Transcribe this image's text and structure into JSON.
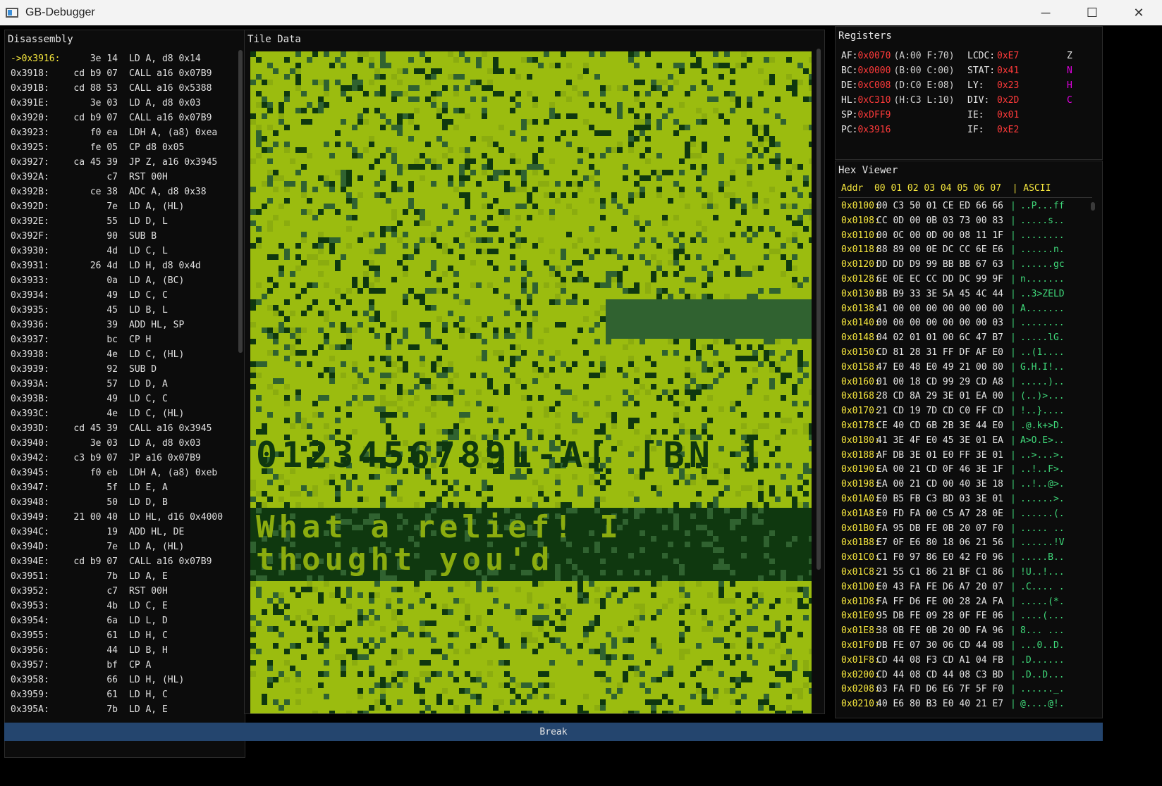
{
  "window": {
    "title": "GB-Debugger",
    "minimize": "─",
    "maximize": "☐",
    "close": "✕"
  },
  "disassembly": {
    "title": "Disassembly",
    "rows": [
      {
        "addr": "->0x3916:",
        "bytes": "3e 14",
        "instr": "LD A, d8 0x14",
        "current": true
      },
      {
        "addr": "0x3918:",
        "bytes": "cd b9 07",
        "instr": "CALL a16 0x07B9"
      },
      {
        "addr": "0x391B:",
        "bytes": "cd 88 53",
        "instr": "CALL a16 0x5388"
      },
      {
        "addr": "0x391E:",
        "bytes": "3e 03",
        "instr": "LD A, d8 0x03"
      },
      {
        "addr": "0x3920:",
        "bytes": "cd b9 07",
        "instr": "CALL a16 0x07B9"
      },
      {
        "addr": "0x3923:",
        "bytes": "f0 ea",
        "instr": "LDH A, (a8) 0xea"
      },
      {
        "addr": "0x3925:",
        "bytes": "fe 05",
        "instr": "CP d8 0x05"
      },
      {
        "addr": "0x3927:",
        "bytes": "ca 45 39",
        "instr": "JP Z, a16 0x3945"
      },
      {
        "addr": "0x392A:",
        "bytes": "c7",
        "instr": "RST 00H"
      },
      {
        "addr": "0x392B:",
        "bytes": "ce 38",
        "instr": "ADC A, d8 0x38"
      },
      {
        "addr": "0x392D:",
        "bytes": "7e",
        "instr": "LD A, (HL)"
      },
      {
        "addr": "0x392E:",
        "bytes": "55",
        "instr": "LD D, L"
      },
      {
        "addr": "0x392F:",
        "bytes": "90",
        "instr": "SUB B"
      },
      {
        "addr": "0x3930:",
        "bytes": "4d",
        "instr": "LD C, L"
      },
      {
        "addr": "0x3931:",
        "bytes": "26 4d",
        "instr": "LD H, d8 0x4d"
      },
      {
        "addr": "0x3933:",
        "bytes": "0a",
        "instr": "LD A, (BC)"
      },
      {
        "addr": "0x3934:",
        "bytes": "49",
        "instr": "LD C, C"
      },
      {
        "addr": "0x3935:",
        "bytes": "45",
        "instr": "LD B, L"
      },
      {
        "addr": "0x3936:",
        "bytes": "39",
        "instr": "ADD HL, SP"
      },
      {
        "addr": "0x3937:",
        "bytes": "bc",
        "instr": "CP H"
      },
      {
        "addr": "0x3938:",
        "bytes": "4e",
        "instr": "LD C, (HL)"
      },
      {
        "addr": "0x3939:",
        "bytes": "92",
        "instr": "SUB D"
      },
      {
        "addr": "0x393A:",
        "bytes": "57",
        "instr": "LD D, A"
      },
      {
        "addr": "0x393B:",
        "bytes": "49",
        "instr": "LD C, C"
      },
      {
        "addr": "0x393C:",
        "bytes": "4e",
        "instr": "LD C, (HL)"
      },
      {
        "addr": "0x393D:",
        "bytes": "cd 45 39",
        "instr": "CALL a16 0x3945"
      },
      {
        "addr": "0x3940:",
        "bytes": "3e 03",
        "instr": "LD A, d8 0x03"
      },
      {
        "addr": "0x3942:",
        "bytes": "c3 b9 07",
        "instr": "JP a16 0x07B9"
      },
      {
        "addr": "0x3945:",
        "bytes": "f0 eb",
        "instr": "LDH A, (a8) 0xeb"
      },
      {
        "addr": "0x3947:",
        "bytes": "5f",
        "instr": "LD E, A"
      },
      {
        "addr": "0x3948:",
        "bytes": "50",
        "instr": "LD D, B"
      },
      {
        "addr": "0x3949:",
        "bytes": "21 00 40",
        "instr": "LD HL, d16 0x4000"
      },
      {
        "addr": "0x394C:",
        "bytes": "19",
        "instr": "ADD HL, DE"
      },
      {
        "addr": "0x394D:",
        "bytes": "7e",
        "instr": "LD A, (HL)"
      },
      {
        "addr": "0x394E:",
        "bytes": "cd b9 07",
        "instr": "CALL a16 0x07B9"
      },
      {
        "addr": "0x3951:",
        "bytes": "7b",
        "instr": "LD A, E"
      },
      {
        "addr": "0x3952:",
        "bytes": "c7",
        "instr": "RST 00H"
      },
      {
        "addr": "0x3953:",
        "bytes": "4b",
        "instr": "LD C, E"
      },
      {
        "addr": "0x3954:",
        "bytes": "6a",
        "instr": "LD L, D"
      },
      {
        "addr": "0x3955:",
        "bytes": "61",
        "instr": "LD H, C"
      },
      {
        "addr": "0x3956:",
        "bytes": "44",
        "instr": "LD B, H"
      },
      {
        "addr": "0x3957:",
        "bytes": "bf",
        "instr": "CP A"
      },
      {
        "addr": "0x3958:",
        "bytes": "66",
        "instr": "LD H, (HL)"
      },
      {
        "addr": "0x3959:",
        "bytes": "61",
        "instr": "LD H, C"
      },
      {
        "addr": "0x395A:",
        "bytes": "7b",
        "instr": "LD A, E"
      }
    ]
  },
  "tile_data": {
    "title": "Tile Data",
    "palette": [
      "#9bbc0f",
      "#8bac0f",
      "#306230",
      "#0f380f"
    ],
    "digits_text": "0123456789L-A[ [BN ]",
    "message_line1": "What a relief! I",
    "message_line2": "thought you'd"
  },
  "registers": {
    "title": "Registers",
    "rows": [
      {
        "name": "AF:",
        "value": "0x0070",
        "detail": "(A:00 F:70)"
      },
      {
        "name": "BC:",
        "value": "0x0000",
        "detail": "(B:00 C:00)"
      },
      {
        "name": "DE:",
        "value": "0xC008",
        "detail": "(D:C0 E:08)"
      },
      {
        "name": "HL:",
        "value": "0xC310",
        "detail": "(H:C3 L:10)"
      },
      {
        "name": "SP:",
        "value": "0xDFF9",
        "detail": ""
      },
      {
        "name": "PC:",
        "value": "0x3916",
        "detail": ""
      }
    ],
    "io": [
      {
        "name": "LCDC:",
        "value": "0xE7"
      },
      {
        "name": "STAT:",
        "value": "0x41"
      },
      {
        "name": "LY:",
        "value": "0x23"
      },
      {
        "name": "DIV:",
        "value": "0x2D"
      },
      {
        "name": "IE:",
        "value": "0x01"
      },
      {
        "name": "IF:",
        "value": "0xE2"
      }
    ],
    "flags": [
      {
        "name": "Z",
        "color": "#e6e6e6"
      },
      {
        "name": "N",
        "color": "#e000e0"
      },
      {
        "name": "H",
        "color": "#e000e0"
      },
      {
        "name": "C",
        "color": "#e000e0"
      }
    ]
  },
  "hex_viewer": {
    "title": "Hex Viewer",
    "header": "Addr  00 01 02 03 04 05 06 07  | ASCII",
    "rows": [
      {
        "addr": "0x0100:",
        "bytes": "00 C3 50 01 CE ED 66 66",
        "ascii": "..P...ff"
      },
      {
        "addr": "0x0108:",
        "bytes": "CC 0D 00 0B 03 73 00 83",
        "ascii": ".....s.."
      },
      {
        "addr": "0x0110:",
        "bytes": "00 0C 00 0D 00 08 11 1F",
        "ascii": "........"
      },
      {
        "addr": "0x0118:",
        "bytes": "88 89 00 0E DC CC 6E E6",
        "ascii": "......n."
      },
      {
        "addr": "0x0120:",
        "bytes": "DD DD D9 99 BB BB 67 63",
        "ascii": "......gc"
      },
      {
        "addr": "0x0128:",
        "bytes": "6E 0E EC CC DD DC 99 9F",
        "ascii": "n......."
      },
      {
        "addr": "0x0130:",
        "bytes": "BB B9 33 3E 5A 45 4C 44",
        "ascii": "..3>ZELD"
      },
      {
        "addr": "0x0138:",
        "bytes": "41 00 00 00 00 00 00 00",
        "ascii": "A......."
      },
      {
        "addr": "0x0140:",
        "bytes": "00 00 00 00 00 00 00 03",
        "ascii": "........"
      },
      {
        "addr": "0x0148:",
        "bytes": "04 02 01 01 00 6C 47 B7",
        "ascii": ".....lG."
      },
      {
        "addr": "0x0150:",
        "bytes": "CD 81 28 31 FF DF AF E0",
        "ascii": "..(1...."
      },
      {
        "addr": "0x0158:",
        "bytes": "47 E0 48 E0 49 21 00 80",
        "ascii": "G.H.I!.."
      },
      {
        "addr": "0x0160:",
        "bytes": "01 00 18 CD 99 29 CD A8",
        "ascii": ".....).."
      },
      {
        "addr": "0x0168:",
        "bytes": "28 CD 8A 29 3E 01 EA 00",
        "ascii": "(..)>..."
      },
      {
        "addr": "0x0170:",
        "bytes": "21 CD 19 7D CD C0 FF CD",
        "ascii": "!..}...."
      },
      {
        "addr": "0x0178:",
        "bytes": "CE 40 CD 6B 2B 3E 44 E0",
        "ascii": ".@.k+>D."
      },
      {
        "addr": "0x0180:",
        "bytes": "41 3E 4F E0 45 3E 01 EA",
        "ascii": "A>O.E>.."
      },
      {
        "addr": "0x0188:",
        "bytes": "AF DB 3E 01 E0 FF 3E 01",
        "ascii": "..>...>."
      },
      {
        "addr": "0x0190:",
        "bytes": "EA 00 21 CD 0F 46 3E 1F",
        "ascii": "..!..F>."
      },
      {
        "addr": "0x0198:",
        "bytes": "EA 00 21 CD 00 40 3E 18",
        "ascii": "..!..@>."
      },
      {
        "addr": "0x01A0:",
        "bytes": "E0 B5 FB C3 BD 03 3E 01",
        "ascii": "......>."
      },
      {
        "addr": "0x01A8:",
        "bytes": "E0 FD FA 00 C5 A7 28 0E",
        "ascii": "......(."
      },
      {
        "addr": "0x01B0:",
        "bytes": "FA 95 DB FE 0B 20 07 F0",
        "ascii": "..... .."
      },
      {
        "addr": "0x01B8:",
        "bytes": "E7 0F E6 80 18 06 21 56",
        "ascii": "......!V"
      },
      {
        "addr": "0x01C0:",
        "bytes": "C1 F0 97 86 E0 42 F0 96",
        "ascii": ".....B.."
      },
      {
        "addr": "0x01C8:",
        "bytes": "21 55 C1 86 21 BF C1 86",
        "ascii": "!U..!..."
      },
      {
        "addr": "0x01D0:",
        "bytes": "E0 43 FA FE D6 A7 20 07",
        "ascii": ".C.... ."
      },
      {
        "addr": "0x01D8:",
        "bytes": "FA FF D6 FE 00 28 2A FA",
        "ascii": ".....(*."
      },
      {
        "addr": "0x01E0:",
        "bytes": "95 DB FE 09 28 0F FE 06",
        "ascii": "....(..."
      },
      {
        "addr": "0x01E8:",
        "bytes": "38 0B FE 0B 20 0D FA 96",
        "ascii": "8... ..."
      },
      {
        "addr": "0x01F0:",
        "bytes": "DB FE 07 30 06 CD 44 08",
        "ascii": "...0..D."
      },
      {
        "addr": "0x01F8:",
        "bytes": "CD 44 08 F3 CD A1 04 FB",
        "ascii": ".D......"
      },
      {
        "addr": "0x0200:",
        "bytes": "CD 44 08 CD 44 08 C3 BD",
        "ascii": ".D..D..."
      },
      {
        "addr": "0x0208:",
        "bytes": "03 FA FD D6 E6 7F 5F F0",
        "ascii": "......_."
      },
      {
        "addr": "0x0210:",
        "bytes": "40 E6 80 B3 E0 40 21 E7",
        "ascii": "@....@!."
      }
    ]
  },
  "break_button": {
    "label": "Break"
  }
}
